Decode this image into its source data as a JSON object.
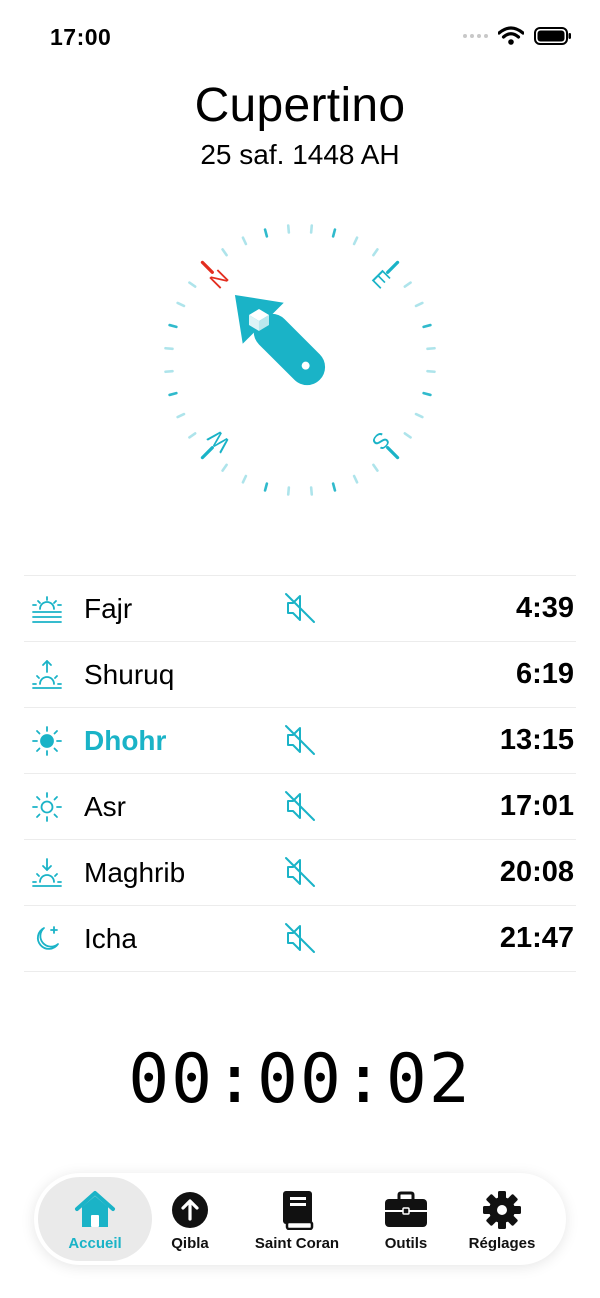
{
  "status_bar": {
    "time": "17:00"
  },
  "header": {
    "city": "Cupertino",
    "hijri_date": "25 saf. 1448 AH"
  },
  "compass": {
    "north": "N",
    "east": "E",
    "south": "S",
    "west": "W",
    "accent_color": "#1ab3c7",
    "north_color": "#e32d1f"
  },
  "prayers": [
    {
      "name": "Fajr",
      "time": "4:39",
      "icon": "sunrise-lines-icon",
      "muted": true
    },
    {
      "name": "Shuruq",
      "time": "6:19",
      "icon": "sunrise-arrow-icon",
      "muted": false
    },
    {
      "name": "Dhohr",
      "time": "13:15",
      "icon": "sun-filled-icon",
      "muted": true,
      "active": true
    },
    {
      "name": "Asr",
      "time": "17:01",
      "icon": "sun-outline-icon",
      "muted": true
    },
    {
      "name": "Maghrib",
      "time": "20:08",
      "icon": "sunset-arrow-icon",
      "muted": true
    },
    {
      "name": "Icha",
      "time": "21:47",
      "icon": "moon-stars-icon",
      "muted": true
    }
  ],
  "countdown": "00:00:02",
  "tabs": [
    {
      "label": "Accueil",
      "icon": "house-icon",
      "selected": true
    },
    {
      "label": "Qibla",
      "icon": "arrow-up-circle-icon"
    },
    {
      "label": "Saint Coran",
      "icon": "book-icon"
    },
    {
      "label": "Outils",
      "icon": "briefcase-icon"
    },
    {
      "label": "Réglages",
      "icon": "gear-icon"
    }
  ],
  "colors": {
    "accent": "#1ab3c7",
    "divider": "#ececec",
    "tab_selected_bg": "#eaeaea"
  }
}
